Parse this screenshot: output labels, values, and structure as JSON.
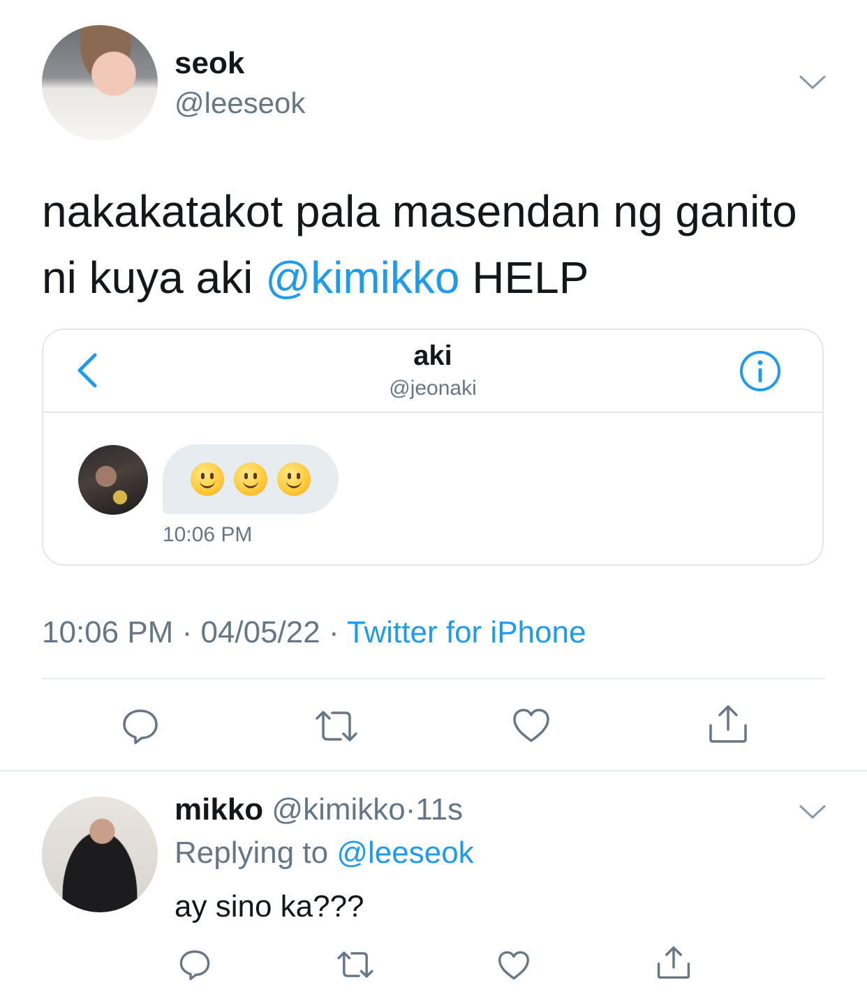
{
  "tweet": {
    "author_name": "seok",
    "author_handle": "@leeseok",
    "text_before": "nakakatakot pala masendan ng ganito ni kuya aki ",
    "mention": "@kimikko",
    "text_after": " HELP",
    "time": "10:06 PM",
    "dot1": " · ",
    "date": "04/05/22",
    "dot2": " · ",
    "source": "Twitter for iPhone"
  },
  "dm_screenshot": {
    "name": "aki",
    "handle": "@jeonaki",
    "message_emojis": [
      "slightly-smiling-face",
      "slightly-smiling-face",
      "slightly-smiling-face"
    ],
    "message_time": "10:06 PM"
  },
  "reply": {
    "author_name": "mikko",
    "author_handle": "@kimikko",
    "age": "·11s",
    "replying_prefix": "Replying to ",
    "replying_to": "@leeseok",
    "text": "ay sino ka???"
  },
  "icons": [
    "chevron-down-icon",
    "back-chevron-icon",
    "info-icon",
    "reply-icon",
    "retweet-icon",
    "like-icon",
    "share-icon"
  ],
  "colors": {
    "accent": "#1d9bf0",
    "secondary_text": "#657786",
    "divider": "#e6ecf0",
    "bubble": "#e6ecf0"
  }
}
